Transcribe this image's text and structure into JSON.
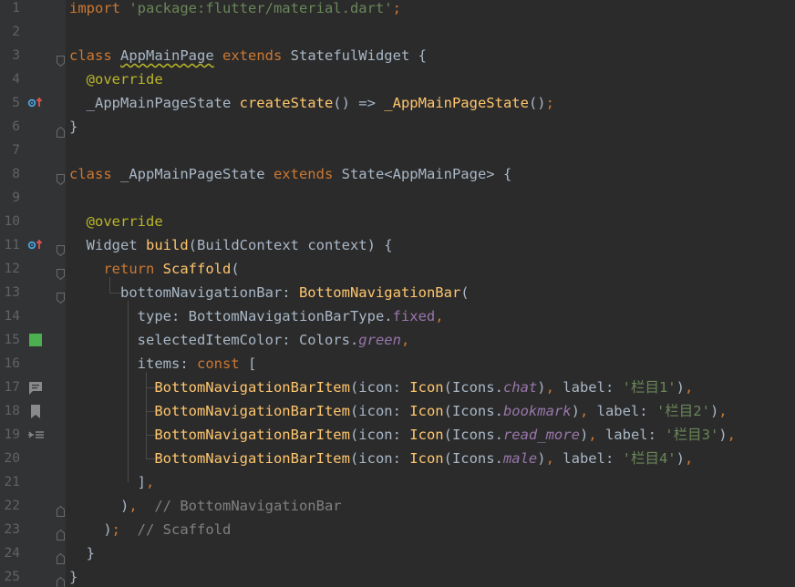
{
  "editor": {
    "lines": [
      {
        "n": "1",
        "tokens": [
          {
            "t": "import ",
            "c": "kw"
          },
          {
            "t": "'package:flutter/material.dart'",
            "c": "str"
          },
          {
            "t": ";",
            "c": "kw"
          }
        ]
      },
      {
        "n": "2",
        "tokens": []
      },
      {
        "n": "3",
        "tokens": [
          {
            "t": "class ",
            "c": "kw"
          },
          {
            "t": "AppMainPage",
            "c": "def wavy"
          },
          {
            "t": " extends ",
            "c": "kw"
          },
          {
            "t": "StatefulWidget {",
            "c": "def"
          }
        ]
      },
      {
        "n": "4",
        "tokens": [
          {
            "t": "  @override",
            "c": "ann"
          }
        ]
      },
      {
        "n": "5",
        "tokens": [
          {
            "t": "  _AppMainPageState ",
            "c": "def"
          },
          {
            "t": "createState",
            "c": "fn"
          },
          {
            "t": "() => ",
            "c": "def"
          },
          {
            "t": "_AppMainPageState",
            "c": "fn"
          },
          {
            "t": "()",
            "c": "def"
          },
          {
            "t": ";",
            "c": "kw"
          }
        ]
      },
      {
        "n": "6",
        "tokens": [
          {
            "t": "}",
            "c": "def"
          }
        ]
      },
      {
        "n": "7",
        "tokens": []
      },
      {
        "n": "8",
        "tokens": [
          {
            "t": "class ",
            "c": "kw"
          },
          {
            "t": "_AppMainPageState",
            "c": "def"
          },
          {
            "t": " extends ",
            "c": "kw"
          },
          {
            "t": "State<AppMainPage> {",
            "c": "def"
          }
        ]
      },
      {
        "n": "9",
        "tokens": []
      },
      {
        "n": "10",
        "tokens": [
          {
            "t": "  @override",
            "c": "ann"
          }
        ]
      },
      {
        "n": "11",
        "tokens": [
          {
            "t": "  Widget ",
            "c": "def"
          },
          {
            "t": "build",
            "c": "fn"
          },
          {
            "t": "(BuildContext context) {",
            "c": "def"
          }
        ]
      },
      {
        "n": "12",
        "tokens": [
          {
            "t": "    return ",
            "c": "kw"
          },
          {
            "t": "Scaffold",
            "c": "fn"
          },
          {
            "t": "(",
            "c": "def"
          }
        ]
      },
      {
        "n": "13",
        "tokens": [
          {
            "t": "      bottomNavigationBar: ",
            "c": "def"
          },
          {
            "t": "BottomNavigationBar",
            "c": "fn"
          },
          {
            "t": "(",
            "c": "def"
          }
        ]
      },
      {
        "n": "14",
        "tokens": [
          {
            "t": "        type: BottomNavigationBarType.",
            "c": "def"
          },
          {
            "t": "fixed",
            "c": "fld"
          },
          {
            "t": ",",
            "c": "kw"
          }
        ]
      },
      {
        "n": "15",
        "tokens": [
          {
            "t": "        selectedItemColor: Colors.",
            "c": "def"
          },
          {
            "t": "green",
            "c": "itl"
          },
          {
            "t": ",",
            "c": "kw"
          }
        ]
      },
      {
        "n": "16",
        "tokens": [
          {
            "t": "        items: ",
            "c": "def"
          },
          {
            "t": "const ",
            "c": "kw"
          },
          {
            "t": "[",
            "c": "def"
          }
        ]
      },
      {
        "n": "17",
        "tokens": [
          {
            "t": "          BottomNavigationBarItem",
            "c": "fn"
          },
          {
            "t": "(icon: ",
            "c": "def"
          },
          {
            "t": "Icon",
            "c": "fn"
          },
          {
            "t": "(Icons.",
            "c": "def"
          },
          {
            "t": "chat",
            "c": "itl"
          },
          {
            "t": ")",
            "c": "def"
          },
          {
            "t": ", ",
            "c": "kw"
          },
          {
            "t": "label: ",
            "c": "def"
          },
          {
            "t": "'栏目1'",
            "c": "str"
          },
          {
            "t": ")",
            "c": "def"
          },
          {
            "t": ",",
            "c": "kw"
          }
        ]
      },
      {
        "n": "18",
        "tokens": [
          {
            "t": "          BottomNavigationBarItem",
            "c": "fn"
          },
          {
            "t": "(icon: ",
            "c": "def"
          },
          {
            "t": "Icon",
            "c": "fn"
          },
          {
            "t": "(Icons.",
            "c": "def"
          },
          {
            "t": "bookmark",
            "c": "itl"
          },
          {
            "t": ")",
            "c": "def"
          },
          {
            "t": ", ",
            "c": "kw"
          },
          {
            "t": "label: ",
            "c": "def"
          },
          {
            "t": "'栏目2'",
            "c": "str"
          },
          {
            "t": ")",
            "c": "def"
          },
          {
            "t": ",",
            "c": "kw"
          }
        ]
      },
      {
        "n": "19",
        "tokens": [
          {
            "t": "          BottomNavigationBarItem",
            "c": "fn"
          },
          {
            "t": "(icon: ",
            "c": "def"
          },
          {
            "t": "Icon",
            "c": "fn"
          },
          {
            "t": "(Icons.",
            "c": "def"
          },
          {
            "t": "read_more",
            "c": "itl"
          },
          {
            "t": ")",
            "c": "def"
          },
          {
            "t": ", ",
            "c": "kw"
          },
          {
            "t": "label: ",
            "c": "def"
          },
          {
            "t": "'栏目3'",
            "c": "str"
          },
          {
            "t": ")",
            "c": "def"
          },
          {
            "t": ",",
            "c": "kw"
          }
        ]
      },
      {
        "n": "20",
        "tokens": [
          {
            "t": "          BottomNavigationBarItem",
            "c": "fn"
          },
          {
            "t": "(icon: ",
            "c": "def"
          },
          {
            "t": "Icon",
            "c": "fn"
          },
          {
            "t": "(Icons.",
            "c": "def"
          },
          {
            "t": "male",
            "c": "itl"
          },
          {
            "t": ")",
            "c": "def"
          },
          {
            "t": ", ",
            "c": "kw"
          },
          {
            "t": "label: ",
            "c": "def"
          },
          {
            "t": "'栏目4'",
            "c": "str"
          },
          {
            "t": ")",
            "c": "def"
          },
          {
            "t": ",",
            "c": "kw"
          }
        ]
      },
      {
        "n": "21",
        "tokens": [
          {
            "t": "        ]",
            "c": "def"
          },
          {
            "t": ",",
            "c": "kw"
          }
        ]
      },
      {
        "n": "22",
        "tokens": [
          {
            "t": "      )",
            "c": "def"
          },
          {
            "t": ",",
            "c": "kw"
          },
          {
            "t": "  // BottomNavigationBar",
            "c": "cmt"
          }
        ]
      },
      {
        "n": "23",
        "tokens": [
          {
            "t": "    )",
            "c": "def"
          },
          {
            "t": ";",
            "c": "kw"
          },
          {
            "t": "  // Scaffold",
            "c": "cmt"
          }
        ]
      },
      {
        "n": "24",
        "tokens": [
          {
            "t": "  }",
            "c": "def"
          }
        ]
      },
      {
        "n": "25",
        "tokens": [
          {
            "t": "}",
            "c": "def"
          }
        ]
      }
    ],
    "gutter_markers": [
      {
        "line": 5,
        "icon": "override-method-icon"
      },
      {
        "line": 11,
        "icon": "override-method-icon"
      },
      {
        "line": 15,
        "icon": "color-swatch-icon",
        "color": "#4caf50"
      },
      {
        "line": 17,
        "icon": "chat-icon"
      },
      {
        "line": 18,
        "icon": "bookmark-icon"
      },
      {
        "line": 19,
        "icon": "read-more-icon"
      }
    ],
    "fold_markers": [
      {
        "line": 3,
        "kind": "open"
      },
      {
        "line": 6,
        "kind": "close"
      },
      {
        "line": 8,
        "kind": "open"
      },
      {
        "line": 11,
        "kind": "open"
      },
      {
        "line": 12,
        "kind": "open"
      },
      {
        "line": 13,
        "kind": "open"
      },
      {
        "line": 22,
        "kind": "close"
      },
      {
        "line": 23,
        "kind": "close"
      },
      {
        "line": 24,
        "kind": "close"
      },
      {
        "line": 25,
        "kind": "close"
      }
    ],
    "colors": {
      "background": "#2b2b2b",
      "keyword": "#cc7832",
      "string": "#6a8759",
      "annotation": "#bbb529",
      "function": "#ffc66d",
      "field": "#9876aa",
      "comment": "#808080",
      "default": "#a9b7c6"
    }
  }
}
